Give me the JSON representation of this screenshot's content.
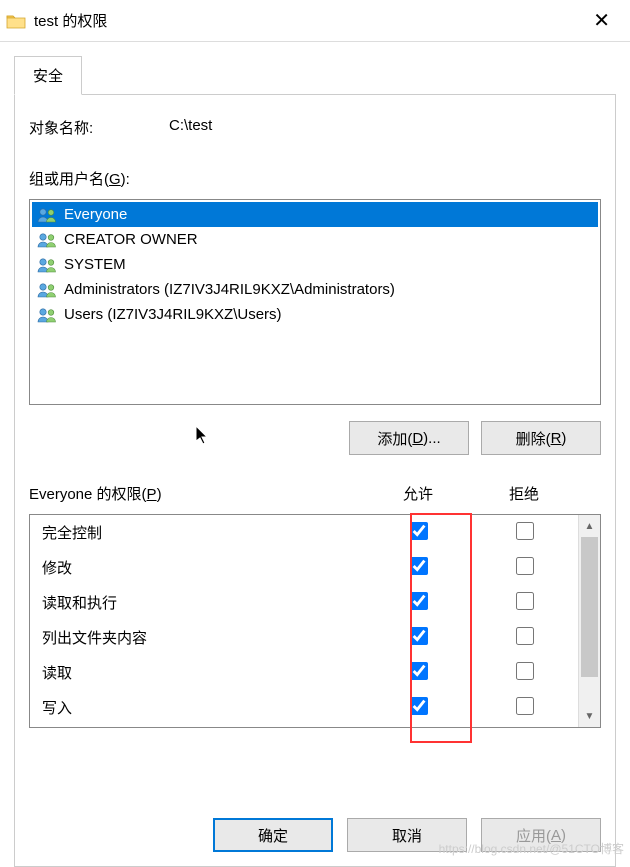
{
  "titlebar": {
    "title": "test 的权限"
  },
  "tab": {
    "security": "安全"
  },
  "object": {
    "label": "对象名称:",
    "value": "C:\\test"
  },
  "groups": {
    "label_pre": "组或用户名(",
    "label_u": "G",
    "label_post": "):",
    "items": [
      {
        "name": "Everyone",
        "selected": true
      },
      {
        "name": "CREATOR OWNER",
        "selected": false
      },
      {
        "name": "SYSTEM",
        "selected": false
      },
      {
        "name": "Administrators (IZ7IV3J4RIL9KXZ\\Administrators)",
        "selected": false
      },
      {
        "name": "Users (IZ7IV3J4RIL9KXZ\\Users)",
        "selected": false
      }
    ]
  },
  "buttons": {
    "add_pre": "添加(",
    "add_u": "D",
    "add_post": ")...",
    "remove_pre": "删除(",
    "remove_u": "R",
    "remove_post": ")",
    "ok": "确定",
    "cancel": "取消",
    "apply_pre": "应用(",
    "apply_u": "A",
    "apply_post": ")"
  },
  "permissions": {
    "title_pre": "Everyone 的权限(",
    "title_u": "P",
    "title_post": ")",
    "col_allow": "允许",
    "col_deny": "拒绝",
    "rows": [
      {
        "name": "完全控制",
        "allow": true,
        "deny": false
      },
      {
        "name": "修改",
        "allow": true,
        "deny": false
      },
      {
        "name": "读取和执行",
        "allow": true,
        "deny": false
      },
      {
        "name": "列出文件夹内容",
        "allow": true,
        "deny": false
      },
      {
        "name": "读取",
        "allow": true,
        "deny": false
      },
      {
        "name": "写入",
        "allow": true,
        "deny": false
      }
    ]
  },
  "watermark": "https://blog.csdn.net/@51CTO博客"
}
